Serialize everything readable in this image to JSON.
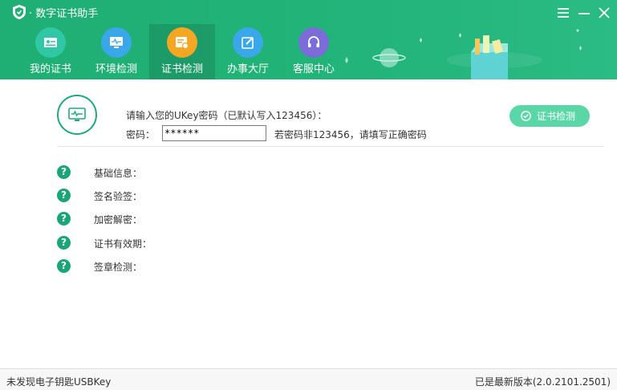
{
  "app": {
    "title": "数字证书助手"
  },
  "colors": {
    "brand": "#1fae74",
    "button": "#5bd7a7"
  },
  "nav": {
    "items": [
      {
        "label": "我的证书",
        "icon": "certificate-card-icon",
        "color": "#2fc7a6"
      },
      {
        "label": "环境检测",
        "icon": "monitor-icon",
        "color": "#3aa8e8"
      },
      {
        "label": "证书检测",
        "icon": "cert-check-icon",
        "color": "#f5a623"
      },
      {
        "label": "办事大厅",
        "icon": "edit-icon",
        "color": "#3aa8e8"
      },
      {
        "label": "客服中心",
        "icon": "headset-icon",
        "color": "#7b6cd9"
      }
    ],
    "active": "证书检测"
  },
  "form": {
    "prompt": "请输入您的UKey密码（已默认写入123456）：",
    "password_label": "密码：",
    "password_value": "******",
    "hint": "若密码非123456，请填写正确密码",
    "check_button": "证书检测"
  },
  "results": [
    {
      "label": "基础信息："
    },
    {
      "label": "签名验签："
    },
    {
      "label": "加密解密："
    },
    {
      "label": "证书有效期："
    },
    {
      "label": "签章检测："
    }
  ],
  "status": {
    "left": "未发现电子钥匙USBKey",
    "right": "已是最新版本(2.0.2101.2501)"
  }
}
